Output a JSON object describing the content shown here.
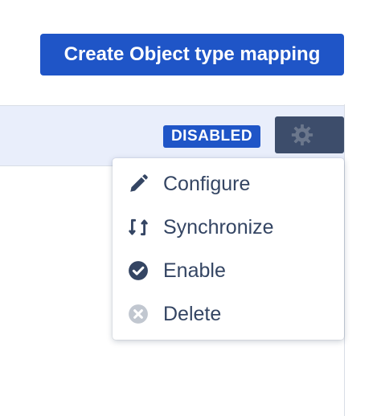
{
  "header": {
    "create_button_label": "Create Object type mapping"
  },
  "row": {
    "status_badge": "DISABLED",
    "actions_icon": "gear-icon"
  },
  "menu": {
    "items": [
      {
        "label": "Configure",
        "icon": "pencil-icon"
      },
      {
        "label": "Synchronize",
        "icon": "sync-icon"
      },
      {
        "label": "Enable",
        "icon": "check-circle-icon"
      },
      {
        "label": "Delete",
        "icon": "close-circle-icon"
      }
    ]
  },
  "colors": {
    "primary": "#1f55c7",
    "row_background": "#e9eefb",
    "gear_button": "#3d4d6b",
    "text": "#344563",
    "disabled_icon": "#c1c7d0"
  }
}
